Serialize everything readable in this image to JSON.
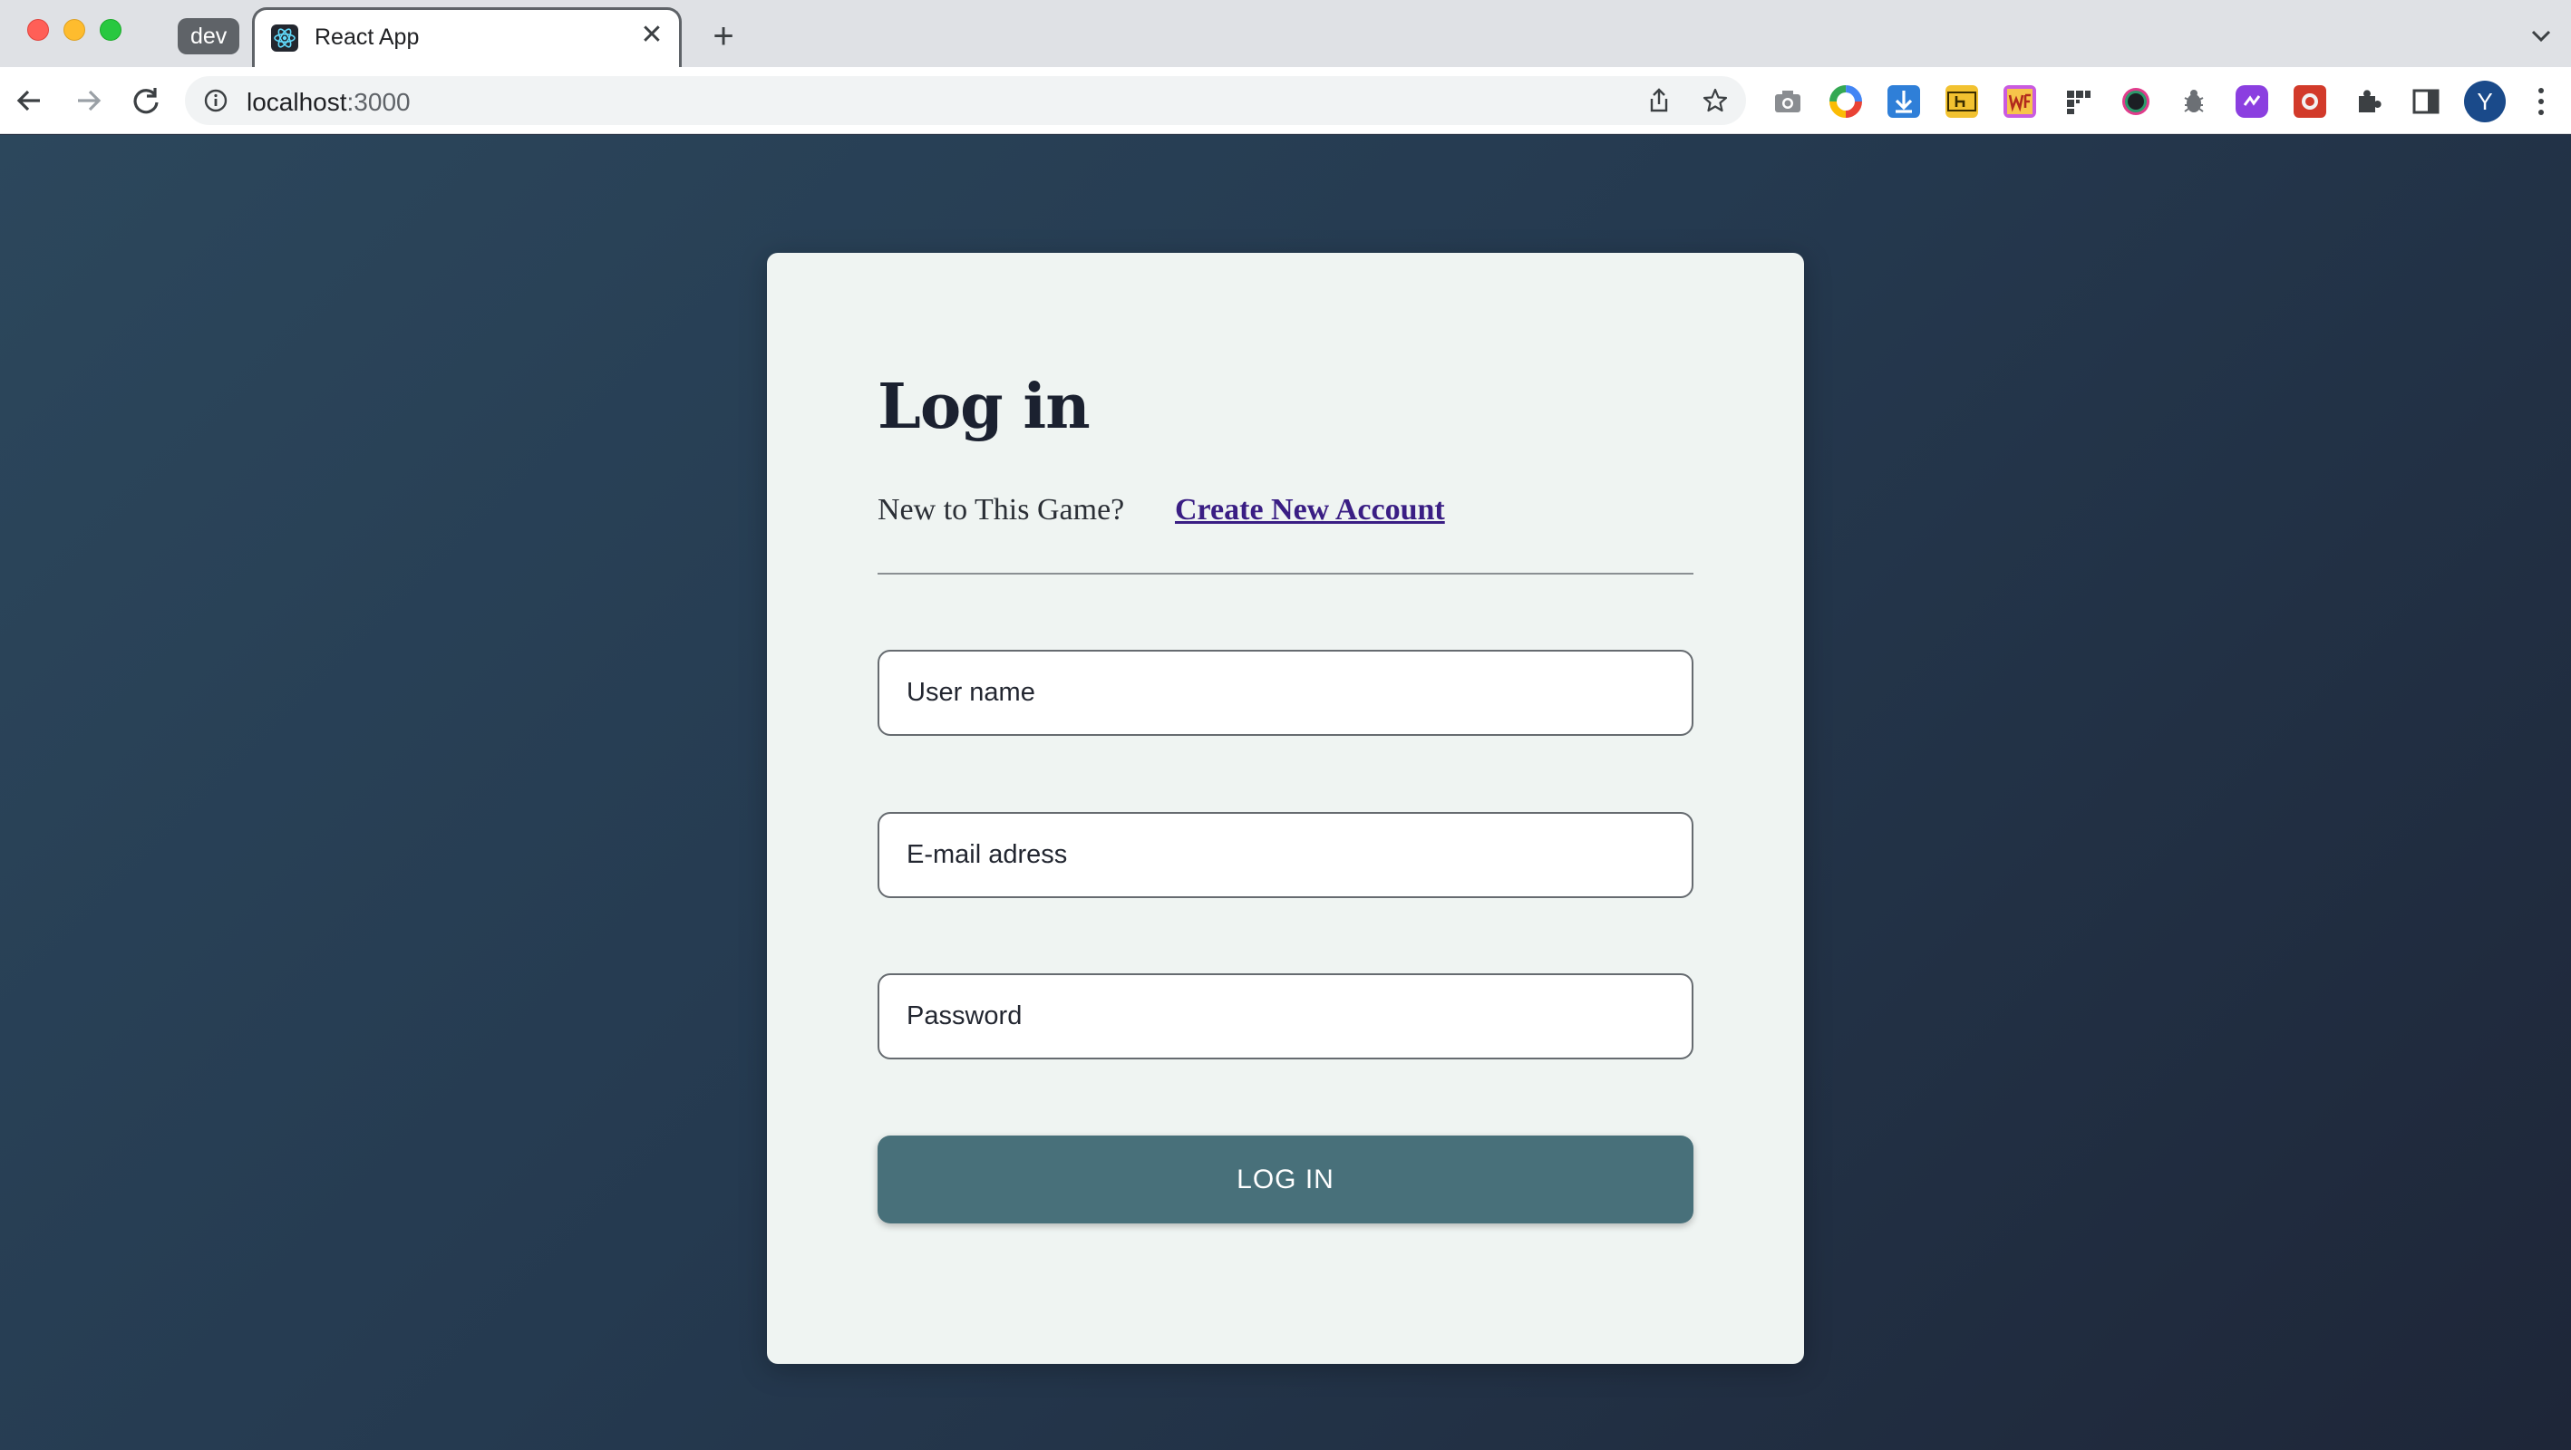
{
  "browser": {
    "tab_group_label": "dev",
    "tab_title": "React App",
    "url_host": "localhost",
    "url_port": ":3000",
    "profile_initial": "Y",
    "extensions": [
      "camera-icon",
      "color-wheel-icon",
      "download-icon",
      "h-icon",
      "wf-icon",
      "grid-icon",
      "circle-icon",
      "bug-icon",
      "link-icon",
      "puzzle-red-icon",
      "extensions-puzzle-icon",
      "side-panel-icon"
    ]
  },
  "login": {
    "title": "Log in",
    "signup_prompt": "New to This Game?",
    "signup_link": "Create New Account",
    "username_placeholder": "User name",
    "email_placeholder": "E-mail adress",
    "password_placeholder": "Password",
    "submit_label": "LOG IN"
  },
  "colors": {
    "card_bg": "#eff4f2",
    "button_bg": "#48707a",
    "link": "#3a1e84",
    "page_bg_start": "#2c475c",
    "page_bg_end": "#1e2638"
  }
}
